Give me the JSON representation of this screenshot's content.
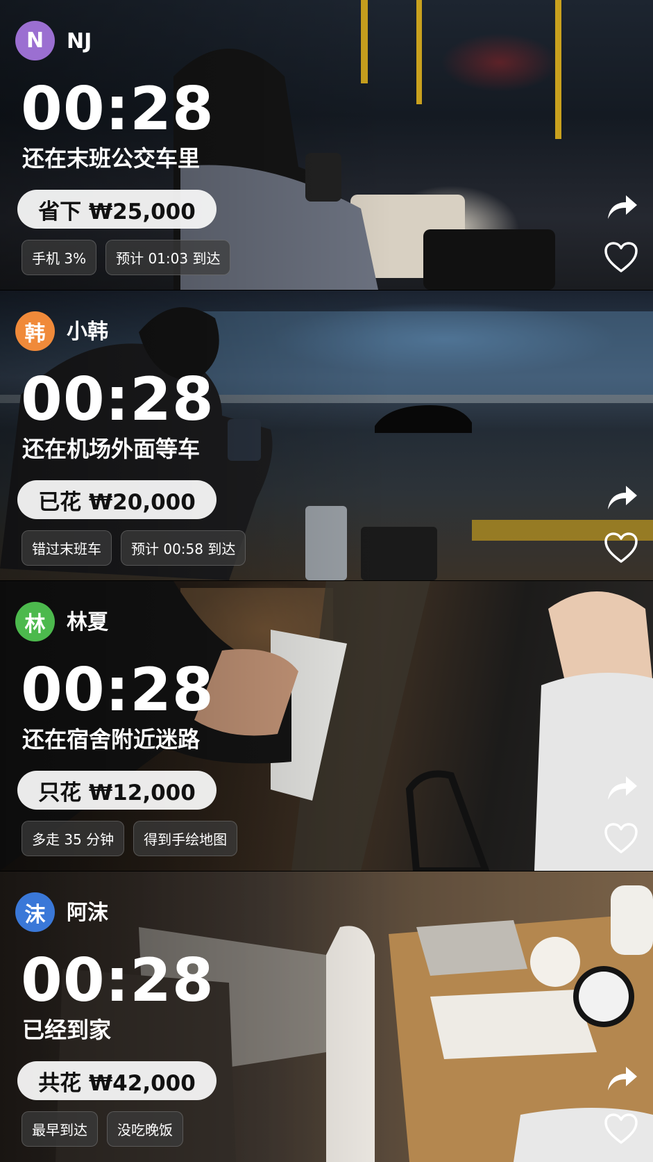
{
  "feed": [
    {
      "avatar": "N",
      "avatar_color": "#9b6fd1",
      "name": "NJ",
      "time": "00:28",
      "status": "还在末班公交车里",
      "money": "省下 ₩25,000",
      "tags": [
        "手机 3%",
        "预计 01:03 到达"
      ]
    },
    {
      "avatar": "韩",
      "avatar_color": "#f08a3a",
      "name": "小韩",
      "time": "00:28",
      "status": "还在机场外面等车",
      "money": "已花 ₩20,000",
      "tags": [
        "错过末班车",
        "预计 00:58 到达"
      ]
    },
    {
      "avatar": "林",
      "avatar_color": "#4cb94d",
      "name": "林夏",
      "time": "00:28",
      "status": "还在宿舍附近迷路",
      "money": "只花 ₩12,000",
      "tags": [
        "多走 35 分钟",
        "得到手绘地图"
      ]
    },
    {
      "avatar": "沫",
      "avatar_color": "#3a78d8",
      "name": "阿沫",
      "time": "00:28",
      "status": "已经到家",
      "money": "共花 ₩42,000",
      "tags": [
        "最早到达",
        "没吃晚饭"
      ]
    }
  ],
  "icons": {
    "share": "share-arrow-icon",
    "like": "heart-outline-icon"
  }
}
